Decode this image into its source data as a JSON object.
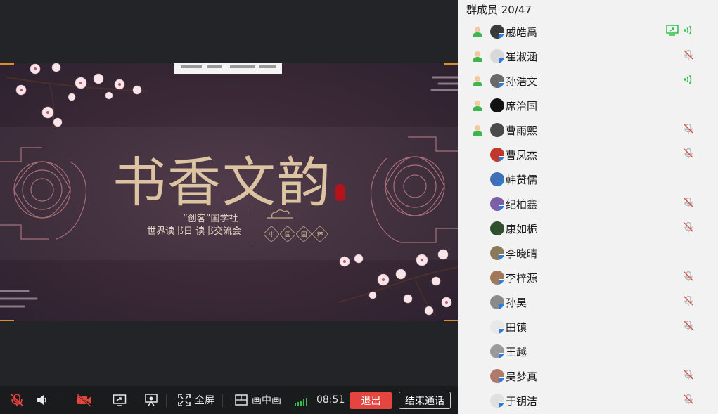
{
  "slide": {
    "title": "书香文韵",
    "subtitle_line1": "“创客”国学社",
    "subtitle_line2": "世界读书日 读书交流会",
    "hex_chars": [
      "中",
      "国",
      "国",
      "粹"
    ]
  },
  "controls": {
    "mic_icon": "mic-muted-icon",
    "speaker_icon": "speaker-icon",
    "camera_icon": "camera-off-icon",
    "share_icon": "screen-share-icon",
    "whiteboard_icon": "presentation-icon",
    "fullscreen_label": "全屏",
    "pip_label": "画中画",
    "timer": "08:51",
    "exit_label": "退出",
    "end_label": "结束通话"
  },
  "colors": {
    "exit_button": "#e4453f",
    "signal": "#2fbf4a",
    "speaking": "#2fbf4a",
    "muted": "#b5b5b5",
    "slide_accent": "#e08a2c"
  },
  "members": {
    "title": "群成员 20/47",
    "items": [
      {
        "name": "戚皓禹",
        "host": true,
        "sharing": true,
        "speaking": true,
        "muted": false,
        "avatar_color": "#3a3a3a",
        "badge": true
      },
      {
        "name": "崔淑涵",
        "host": true,
        "sharing": false,
        "speaking": false,
        "muted": true,
        "avatar_color": "#d8d8d8",
        "badge": true
      },
      {
        "name": "孙浩文",
        "host": true,
        "sharing": false,
        "speaking": true,
        "muted": false,
        "avatar_color": "#6a6a6a",
        "badge": true
      },
      {
        "name": "席治国",
        "host": true,
        "sharing": false,
        "speaking": false,
        "muted": false,
        "avatar_color": "#111111",
        "badge": false
      },
      {
        "name": "曹雨熙",
        "host": true,
        "sharing": false,
        "speaking": false,
        "muted": true,
        "avatar_color": "#4a4a4a",
        "badge": false
      },
      {
        "name": "曹凤杰",
        "host": false,
        "sharing": false,
        "speaking": false,
        "muted": true,
        "avatar_color": "#c0392b",
        "badge": true
      },
      {
        "name": "韩赞儒",
        "host": false,
        "sharing": false,
        "speaking": false,
        "muted": false,
        "avatar_color": "#3f6fb5",
        "badge": true
      },
      {
        "name": "纪柏鑫",
        "host": false,
        "sharing": false,
        "speaking": false,
        "muted": true,
        "avatar_color": "#7d5fa8",
        "badge": true
      },
      {
        "name": "康如栀",
        "host": false,
        "sharing": false,
        "speaking": false,
        "muted": true,
        "avatar_color": "#2f4f2f",
        "badge": false
      },
      {
        "name": "李晓晴",
        "host": false,
        "sharing": false,
        "speaking": false,
        "muted": false,
        "avatar_color": "#8a7a5a",
        "badge": true
      },
      {
        "name": "李梓源",
        "host": false,
        "sharing": false,
        "speaking": false,
        "muted": true,
        "avatar_color": "#a0785a",
        "badge": true
      },
      {
        "name": "孙昊",
        "host": false,
        "sharing": false,
        "speaking": false,
        "muted": true,
        "avatar_color": "#8a8a8a",
        "badge": true
      },
      {
        "name": "田镇",
        "host": false,
        "sharing": false,
        "speaking": false,
        "muted": true,
        "avatar_color": "#e8e8e8",
        "badge": true
      },
      {
        "name": "王越",
        "host": false,
        "sharing": false,
        "speaking": false,
        "muted": false,
        "avatar_color": "#9a9a9a",
        "badge": true
      },
      {
        "name": "吴梦真",
        "host": false,
        "sharing": false,
        "speaking": false,
        "muted": true,
        "avatar_color": "#b07a6a",
        "badge": true
      },
      {
        "name": "于钥洁",
        "host": false,
        "sharing": false,
        "speaking": false,
        "muted": true,
        "avatar_color": "#e0e0e0",
        "badge": true
      }
    ]
  }
}
